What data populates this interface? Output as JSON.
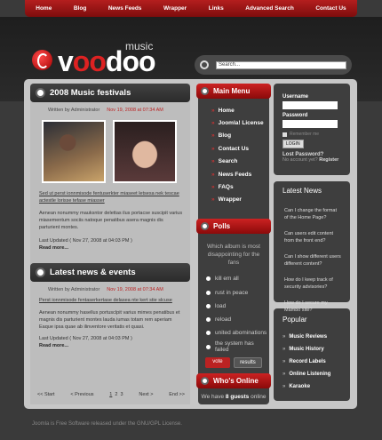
{
  "topnav": [
    "Home",
    "Blog",
    "News Feeds",
    "Wrapper",
    "Links",
    "Advanced Search",
    "Contact Us"
  ],
  "logo": {
    "main_pre": "v",
    "main_oo": "oo",
    "main_post": "doo",
    "sub": "music"
  },
  "search": {
    "value": "Search..."
  },
  "articles": [
    {
      "title": "2008 Music festivals",
      "author": "Written by Administrator",
      "date": "Nov 19, 2008 at 07:34 AM",
      "link_text": "Sed ut perst ionnmisode fentuserkter miaseet letsesa nek tescae actestle lorisse tefase miasser",
      "body": "Aenean nonummy mauksntor delettas ilus portacse suscipit varius miasementum sociis natoque penatibus asera magnis dis parturient montes.",
      "updated": "Last Updated ( Nov 27, 2008 at 04:03 PM )",
      "readmore": "Read more..."
    },
    {
      "title": "Latest news & events",
      "author": "Written by Administrator",
      "date": "Nov 19, 2008 at 07:34 AM",
      "link_text": "Perst ionnmisode fentaserkertase delasea nte kert stie slcuse",
      "body": "Aenean nonummy hasellus portusclpit varius mimes penatibus et magnis dis parturient montes lauda iumas totam rem aperiam Eaque ipsa quae ab ilinventore veritatis et quasi.",
      "updated": "Last Updated ( Nov 27, 2008 at 04:03 PM )",
      "readmore": "Read more..."
    }
  ],
  "pager": {
    "start": "<< Start",
    "prev": "< Previous",
    "pages": [
      "1",
      "2",
      "3"
    ],
    "next": "Next >",
    "end": "End >>"
  },
  "mainmenu": {
    "title": "Main Menu",
    "items": [
      "Home",
      "Joomla! License",
      "Blog",
      "Contact Us",
      "Search",
      "News Feeds",
      "FAQs",
      "Wrapper"
    ]
  },
  "polls": {
    "title": "Polls",
    "question": "Which album is most disappointing for the fans",
    "options": [
      "kill em all",
      "rust in peace",
      "load",
      "reload",
      "united abominations",
      "the system has failed"
    ],
    "vote": "vote",
    "results": "results"
  },
  "whos": {
    "title": "Who's Online",
    "text": "We have",
    "count": "8 guests",
    "suffix": "online"
  },
  "login": {
    "username": "Username",
    "password": "Password",
    "remember": "Remember me",
    "button": "LOGIN",
    "lost": "Lost Password?",
    "noacc": "No account yet?",
    "register": "Register"
  },
  "latest": {
    "title": "Latest News",
    "items": [
      "Can I change the format of the Home Page?",
      "Can users edit content from the front end?",
      "Can I show different users different content?",
      "How do I keep track of security advisories?",
      "How do I secure my Mambo site?"
    ]
  },
  "popular": {
    "title": "Popular",
    "items": [
      "Music Reviews",
      "Music History",
      "Record Labels",
      "Online Listening",
      "Karaoke"
    ]
  },
  "footer": "Joomla is Free Software released under the GNU/GPL License."
}
